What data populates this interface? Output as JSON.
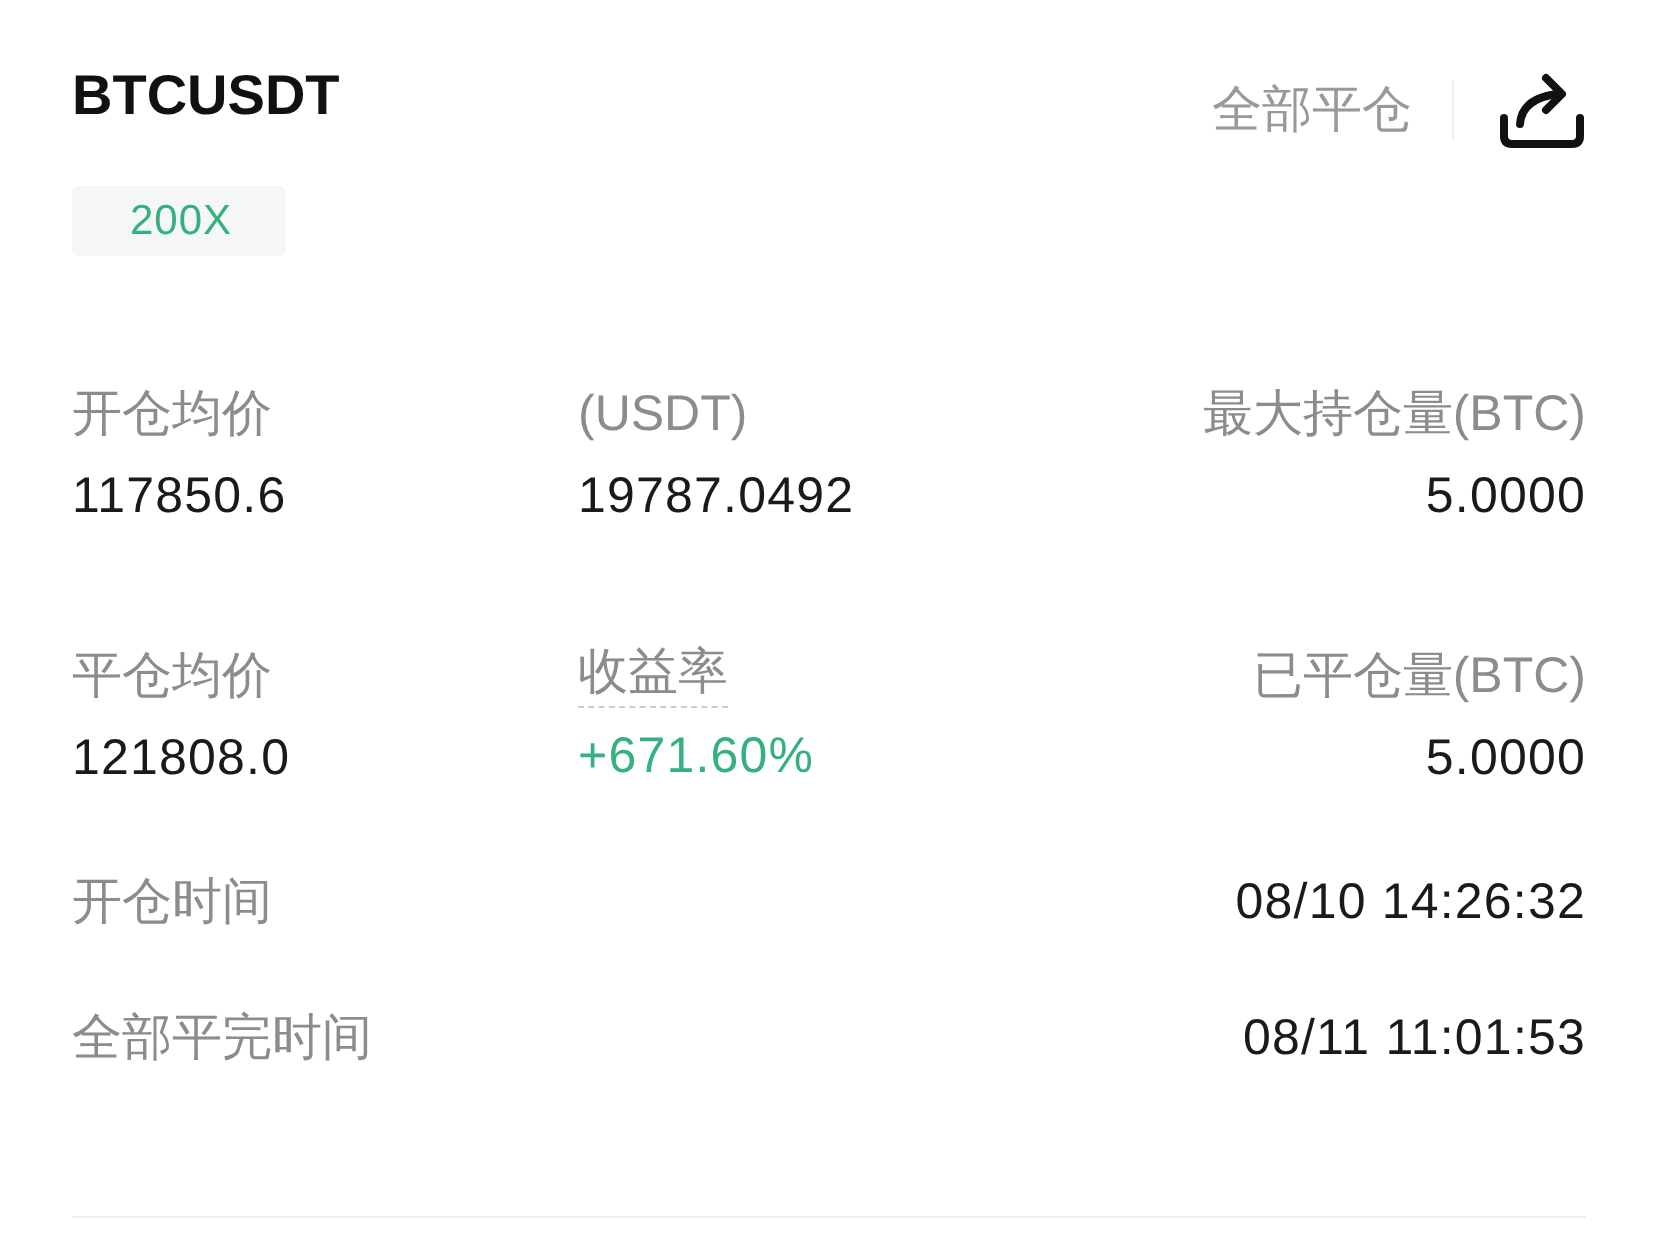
{
  "header": {
    "symbol": "BTCUSDT",
    "leverage": "200X",
    "close_all": "全部平仓"
  },
  "stats": [
    {
      "label": "开仓均价",
      "value": "117850.6",
      "kind": "plain"
    },
    {
      "label": "(USDT)",
      "value": "19787.0492",
      "kind": "plain"
    },
    {
      "label": "最大持仓量(BTC)",
      "value": "5.0000",
      "kind": "plain"
    },
    {
      "label": "平仓均价",
      "value": "121808.0",
      "kind": "plain"
    },
    {
      "label": "收益率",
      "value": "+671.60%",
      "kind": "rate"
    },
    {
      "label": "已平仓量(BTC)",
      "value": "5.0000",
      "kind": "plain"
    }
  ],
  "times": [
    {
      "label": "开仓时间",
      "value": "08/10 14:26:32"
    },
    {
      "label": "全部平完时间",
      "value": "08/11 11:01:53"
    }
  ]
}
